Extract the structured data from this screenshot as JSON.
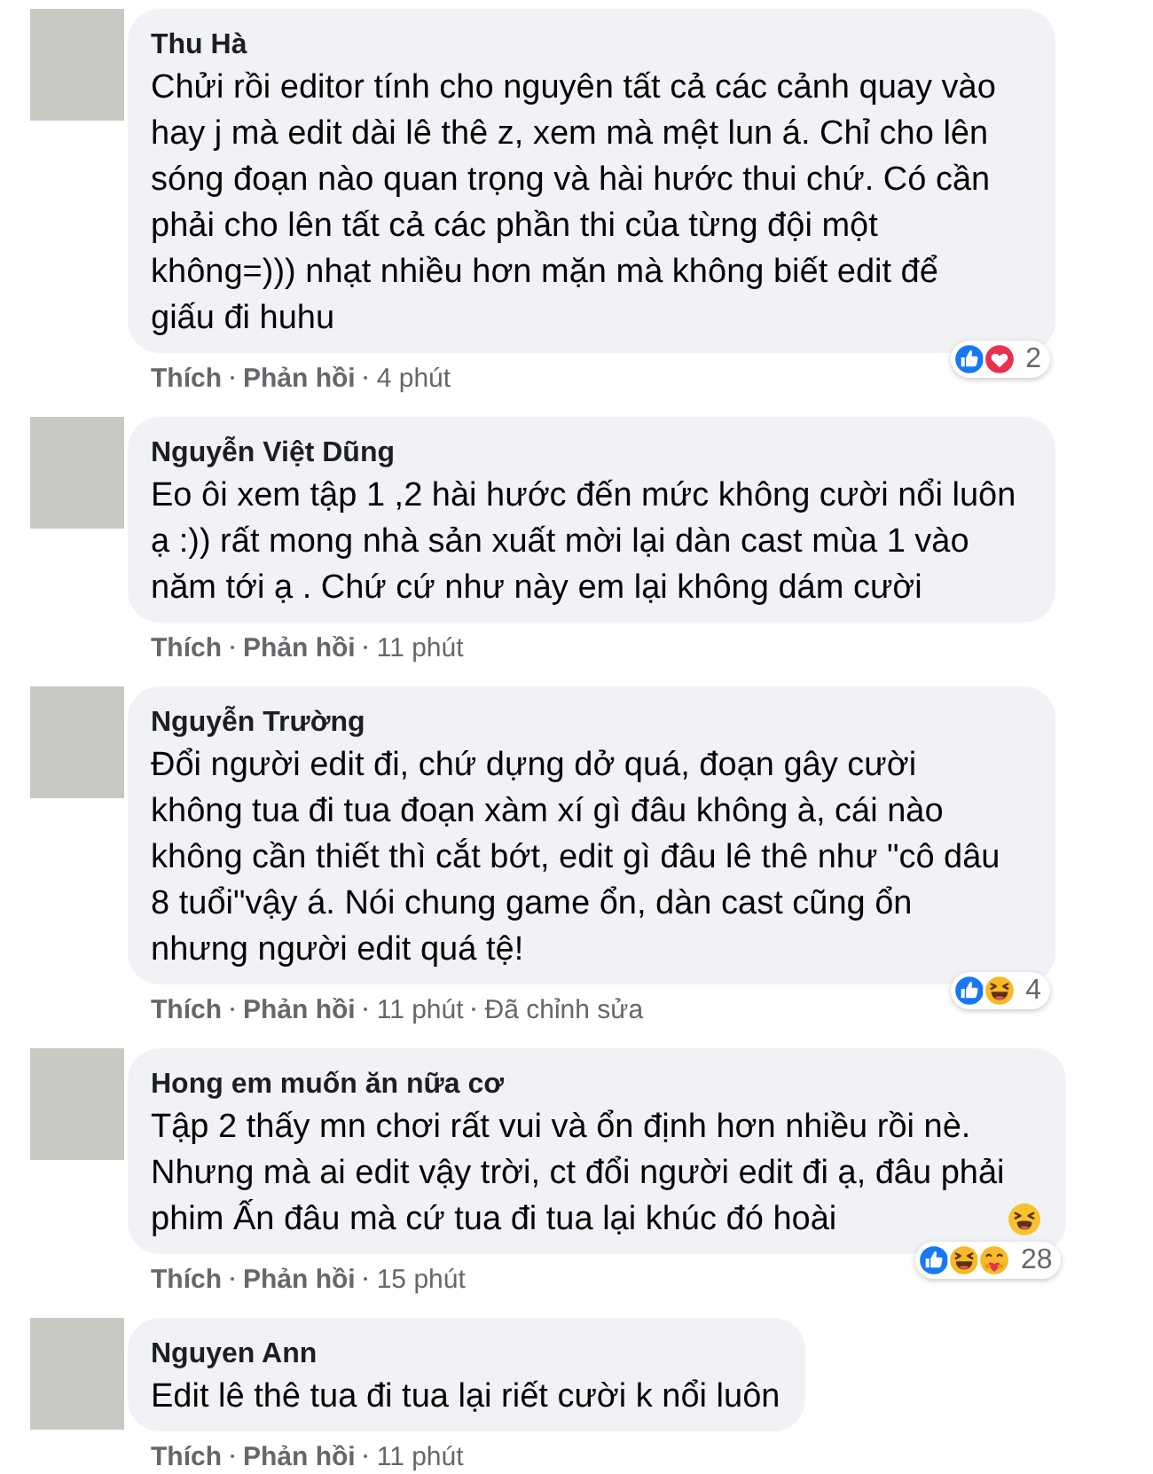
{
  "comments": [
    {
      "author": "Thu Hà",
      "text": "Chửi rồi editor tính cho nguyên tất cả các cảnh quay vào\nhay j mà edit dài lê thê z, xem mà mệt lun á. Chỉ cho lên\nsóng đoạn nào quan trọng và hài hước thui chứ. Có cần\nphải cho lên tất cả các phần thi của từng đội một\nkhông=))) nhạt nhiều hơn mặn mà không biết edit để\ngiấu đi huhu",
      "reactions": {
        "icons": [
          {
            "kind": "like"
          },
          {
            "kind": "love"
          }
        ],
        "count": "2"
      },
      "actions": [
        {
          "kind": "like",
          "label": "Thích"
        },
        {
          "kind": "reply",
          "label": "Phản hồi"
        },
        {
          "kind": "time",
          "label": "4 phút"
        }
      ]
    },
    {
      "author": "Nguyễn Việt Dũng",
      "text": "Eo ôi xem tập 1 ,2 hài hước đến mức không cười nổi luôn\nạ :)) rất mong nhà sản xuất mời lại dàn cast mùa 1 vào\nnăm tới ạ . Chứ cứ như này em lại không dám cười",
      "actions": [
        {
          "kind": "like",
          "label": "Thích"
        },
        {
          "kind": "reply",
          "label": "Phản hồi"
        },
        {
          "kind": "time",
          "label": "11 phút"
        }
      ]
    },
    {
      "author": "Nguyễn Trường",
      "text": "Đổi người edit đi, chứ dựng dở quá, đoạn gây cười\nkhông tua đi tua đoạn xàm xí gì đâu không à, cái nào\nkhông cần thiết thì cắt bớt, edit gì đâu lê thê như \"cô dâu\n8 tuổi\"vậy á. Nói chung game ổn, dàn cast cũng ổn\nnhưng người edit quá tệ!",
      "reactions": {
        "icons": [
          {
            "kind": "like"
          },
          {
            "kind": "haha"
          }
        ],
        "count": "4"
      },
      "actions": [
        {
          "kind": "like",
          "label": "Thích"
        },
        {
          "kind": "reply",
          "label": "Phản hồi"
        },
        {
          "kind": "time",
          "label": "11 phút"
        },
        {
          "kind": "edited",
          "label": "Đã chỉnh sửa"
        }
      ]
    },
    {
      "author": "Hong em muốn ăn nữa cơ",
      "text": "Tập 2 thấy mn chơi rất vui và ổn định hơn nhiều rồi nè.\nNhưng mà ai edit vậy trời, ct đổi người edit đi ạ, đâu phải\nphim Ấn đâu mà cứ tua đi tua lại khúc đó hoài",
      "ends_with_emoji": true,
      "reactions": {
        "icons": [
          {
            "kind": "like"
          },
          {
            "kind": "haha"
          },
          {
            "kind": "care"
          }
        ],
        "count": "28"
      },
      "actions": [
        {
          "kind": "like",
          "label": "Thích"
        },
        {
          "kind": "reply",
          "label": "Phản hồi"
        },
        {
          "kind": "time",
          "label": "15 phút"
        }
      ]
    },
    {
      "author": "Nguyen Ann",
      "text": "Edit lê thê tua đi tua lại riết cười k nổi luôn",
      "actions": [
        {
          "kind": "like",
          "label": "Thích"
        },
        {
          "kind": "reply",
          "label": "Phản hồi"
        },
        {
          "kind": "time",
          "label": "11 phút"
        }
      ]
    }
  ]
}
